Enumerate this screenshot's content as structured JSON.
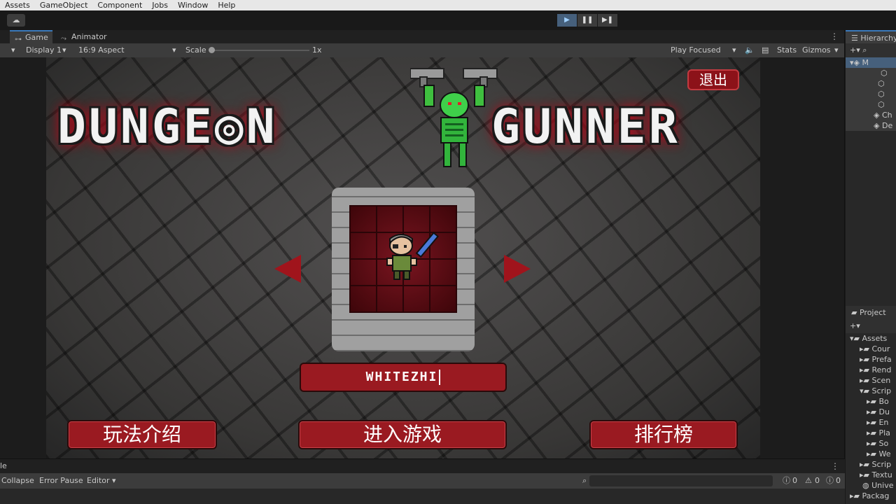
{
  "menu": [
    "Assets",
    "GameObject",
    "Component",
    "Jobs",
    "Window",
    "Help"
  ],
  "toolbar": {
    "cloud": "☁",
    "play": "▶",
    "pause": "❚❚",
    "step": "▶❚"
  },
  "tabs": {
    "game": "Game",
    "animator": "Animator",
    "more": "⋮"
  },
  "gamebar": {
    "display": "Display 1",
    "aspect": "16:9 Aspect",
    "scale_label": "Scale",
    "scale_value": "1x",
    "play_mode": "Play Focused",
    "stats": "Stats",
    "gizmos": "Gizmos"
  },
  "game": {
    "title_left": "DUNGE◎N",
    "title_right": "GUNNER",
    "exit": "退出",
    "player_name": "WHITEZHI",
    "buttons": {
      "howto": "玩法介绍",
      "start": "进入游戏",
      "rank": "排行榜"
    }
  },
  "console": {
    "tab": "le",
    "collapse": "Collapse",
    "error_pause": "Error Pause",
    "editor": "Editor ▾",
    "counts": [
      "0",
      "0",
      "0"
    ]
  },
  "hierarchy": {
    "title": "Hierarchy",
    "rows": [
      "M",
      "",
      "",
      "",
      "",
      "Ch",
      "De"
    ]
  },
  "project": {
    "title": "Project",
    "rows": [
      "Assets",
      "Cour",
      "Prefa",
      "Rend",
      "Scen",
      "Scrip",
      "Bo",
      "Du",
      "En",
      "Pla",
      "So",
      "We",
      "Scrip",
      "Textu",
      "Unive",
      "Packag"
    ]
  }
}
